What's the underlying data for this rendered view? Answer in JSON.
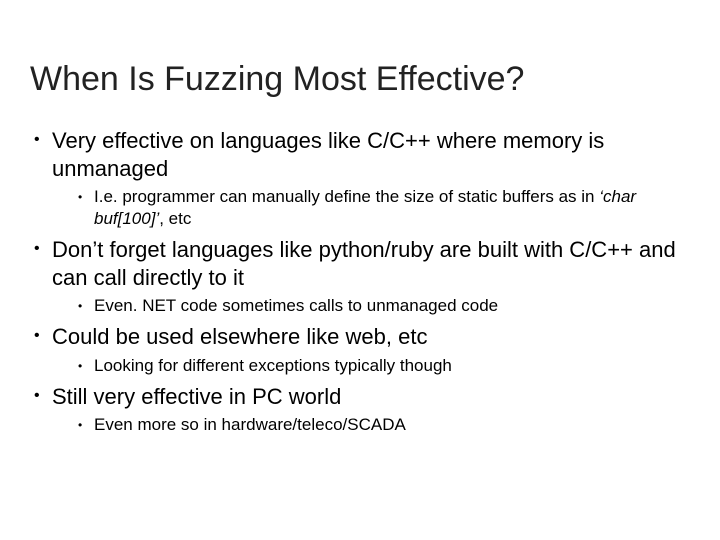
{
  "title": "When Is Fuzzing Most Effective?",
  "bullets": [
    {
      "text": "Very effective on languages like C/C++ where memory is unmanaged",
      "sub": [
        {
          "prefix": "I.e. programmer can manually define the size of static buffers as in ",
          "italic": "‘char buf[100]’",
          "suffix": ", etc"
        }
      ]
    },
    {
      "text": "Don’t forget languages like python/ruby are built with C/C++ and can call directly to it",
      "sub": [
        {
          "text": "Even. NET code sometimes calls to unmanaged code"
        }
      ]
    },
    {
      "text": "Could be used elsewhere like web, etc",
      "sub": [
        {
          "text": "Looking for different exceptions typically though"
        }
      ]
    },
    {
      "text": "Still very effective in PC world",
      "sub": [
        {
          "text": "Even more so in hardware/teleco/SCADA"
        }
      ]
    }
  ]
}
